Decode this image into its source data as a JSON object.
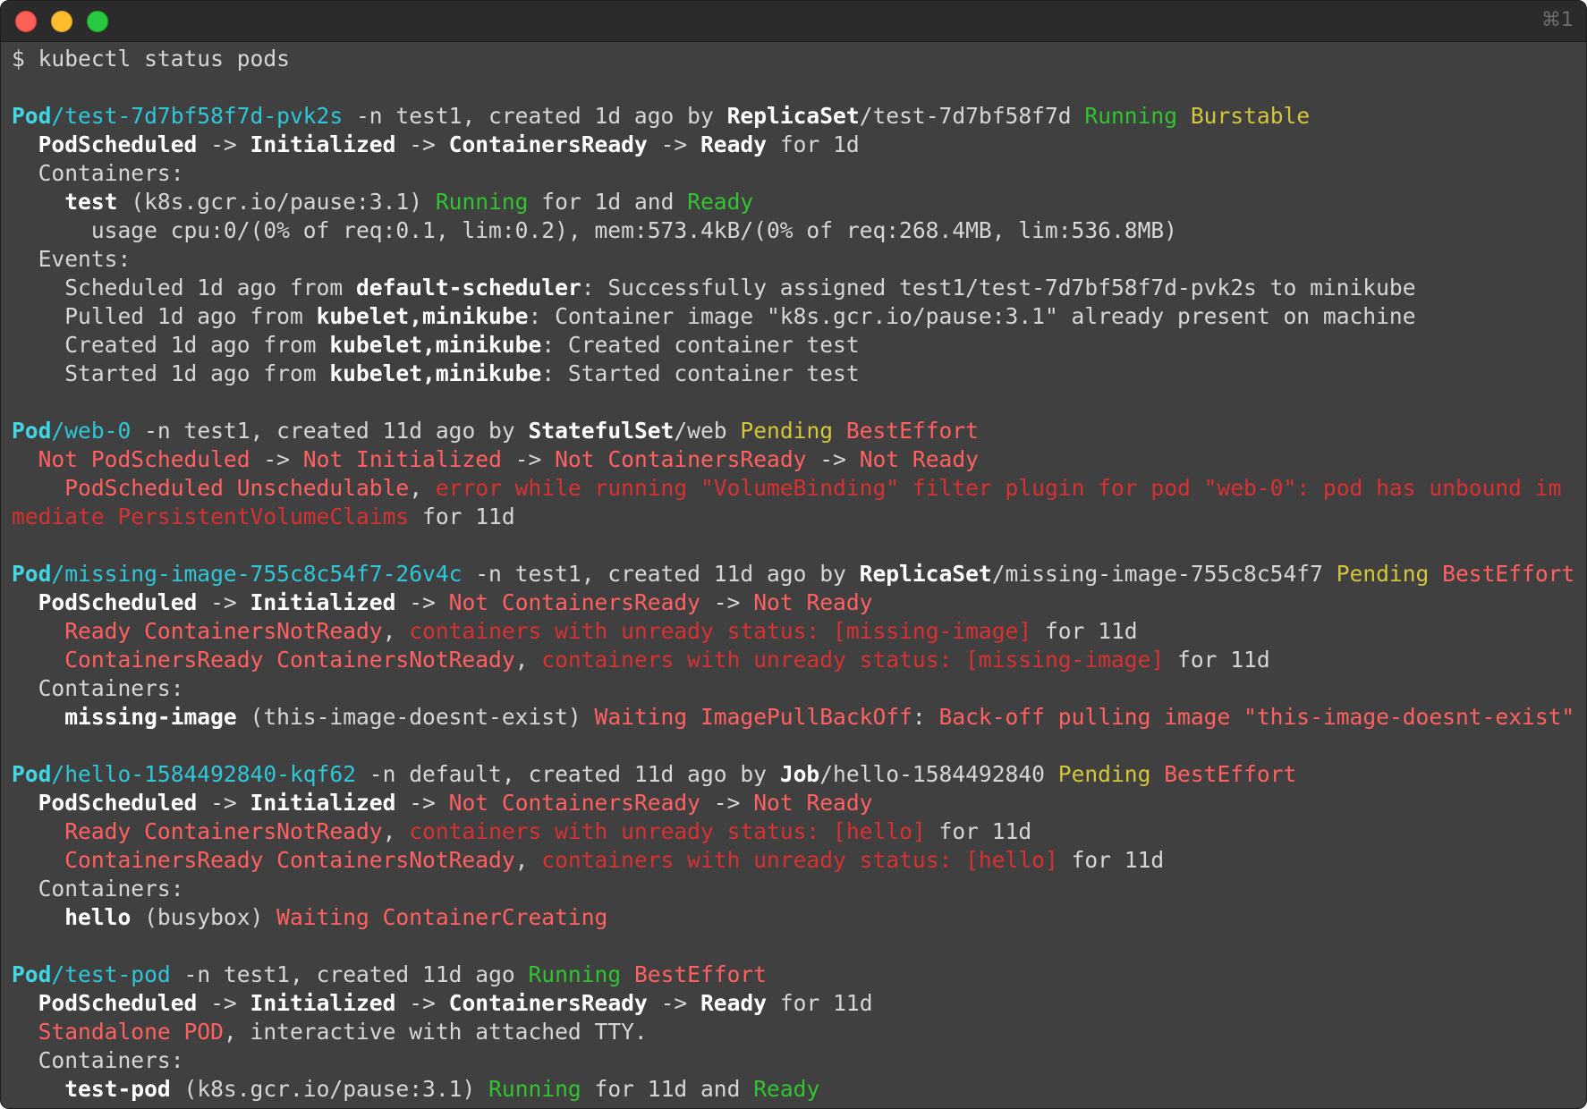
{
  "window": {
    "shortcut": "⌘1",
    "colors": {
      "background": "#404040",
      "titlebar": "#2b2b2b",
      "cyan": "#2ec7d8",
      "green": "#31c331",
      "yellow": "#d4c63a",
      "red": "#ff6161",
      "dark_red": "#d93131"
    }
  },
  "prompt": "$ kubectl status pods",
  "pods": [
    {
      "kind": "Pod",
      "name": "test-7d7bf58f7d-pvk2s",
      "ns_text": " -n test1, created 1d ago by ",
      "owner_kind": "ReplicaSet",
      "owner_name": "/test-7d7bf58f7d ",
      "phase": "Running",
      "qos": "Burstable",
      "conditions": {
        "c1": "PodScheduled",
        "c2": "Initialized",
        "c3": "ContainersReady",
        "c4": "Ready",
        "arrow": " -> ",
        "suffix": " for 1d"
      },
      "containers_label": "Containers:",
      "container": {
        "name": "test",
        "image": " (k8s.gcr.io/pause:3.1) ",
        "state": "Running",
        "for_text": " for 1d and ",
        "ready": "Ready",
        "usage": "usage cpu:0/(0% of req:0.1, lim:0.2), mem:573.4kB/(0% of req:268.4MB, lim:536.8MB)"
      },
      "events_label": "Events:",
      "events": [
        {
          "pre": "Scheduled 1d ago from ",
          "source": "default-scheduler",
          "msg": ": Successfully assigned test1/test-7d7bf58f7d-pvk2s to minikube"
        },
        {
          "pre": "Pulled 1d ago from ",
          "source": "kubelet,minikube",
          "msg": ": Container image \"k8s.gcr.io/pause:3.1\" already present on machine"
        },
        {
          "pre": "Created 1d ago from ",
          "source": "kubelet,minikube",
          "msg": ": Created container test"
        },
        {
          "pre": "Started 1d ago from ",
          "source": "kubelet,minikube",
          "msg": ": Started container test"
        }
      ]
    },
    {
      "kind": "Pod",
      "name": "web-0",
      "ns_text": " -n test1, created 11d ago by ",
      "owner_kind": "StatefulSet",
      "owner_name": "/web ",
      "phase": "Pending",
      "qos": "BestEffort",
      "conditions": {
        "c1": "Not PodScheduled",
        "c2": "Not Initialized",
        "c3": "Not ContainersReady",
        "c4": "Not Ready",
        "arrow": " -> "
      },
      "reason_title": "PodScheduled Unschedulable",
      "reason_comma": ", ",
      "reason_msg": "error while running \"VolumeBinding\" filter plugin for pod \"web-0\": pod has unbound immediate PersistentVolumeClaims",
      "reason_for": " for 11d"
    },
    {
      "kind": "Pod",
      "name": "missing-image-755c8c54f7-26v4c",
      "ns_text": " -n test1, created 11d ago by ",
      "owner_kind": "ReplicaSet",
      "owner_name": "/missing-image-755c8c54f7 ",
      "phase": "Pending",
      "qos": "BestEffort",
      "conditions": {
        "c1": "PodScheduled",
        "c2": "Initialized",
        "c3": "Not ContainersReady",
        "c4": "Not Ready",
        "arrow": " -> "
      },
      "reasons": [
        {
          "title": "Ready ContainersNotReady",
          "comma": ", ",
          "msg": "containers with unready status: [missing-image]",
          "for": " for 11d"
        },
        {
          "title": "ContainersReady ContainersNotReady",
          "comma": ", ",
          "msg": "containers with unready status: [missing-image]",
          "for": " for 11d"
        }
      ],
      "containers_label": "Containers:",
      "container": {
        "name": "missing-image",
        "image": " (this-image-doesnt-exist) ",
        "state": "Waiting ImagePullBackOff",
        "colon": ": ",
        "detail": "Back-off pulling image \"this-image-doesnt-exist\""
      }
    },
    {
      "kind": "Pod",
      "name": "hello-1584492840-kqf62",
      "ns_text": " -n default, created 11d ago by ",
      "owner_kind": "Job",
      "owner_name": "/hello-1584492840 ",
      "phase": "Pending",
      "qos": "BestEffort",
      "conditions": {
        "c1": "PodScheduled",
        "c2": "Initialized",
        "c3": "Not ContainersReady",
        "c4": "Not Ready",
        "arrow": " -> "
      },
      "reasons": [
        {
          "title": "Ready ContainersNotReady",
          "comma": ", ",
          "msg": "containers with unready status: [hello]",
          "for": " for 11d"
        },
        {
          "title": "ContainersReady ContainersNotReady",
          "comma": ", ",
          "msg": "containers with unready status: [hello]",
          "for": " for 11d"
        }
      ],
      "containers_label": "Containers:",
      "container": {
        "name": "hello",
        "image": " (busybox) ",
        "state": "Waiting ContainerCreating"
      }
    },
    {
      "kind": "Pod",
      "name": "test-pod",
      "ns_text": " -n test1, created 11d ago ",
      "phase": "Running",
      "qos": "BestEffort",
      "conditions": {
        "c1": "PodScheduled",
        "c2": "Initialized",
        "c3": "ContainersReady",
        "c4": "Ready",
        "arrow": " -> ",
        "suffix": " for 11d"
      },
      "standalone": "Standalone POD",
      "standalone_rest": ", interactive with attached TTY.",
      "containers_label": "Containers:",
      "container": {
        "name": "test-pod",
        "image": " (k8s.gcr.io/pause:3.1) ",
        "state": "Running",
        "for_text": " for 11d and ",
        "ready": "Ready"
      }
    }
  ]
}
